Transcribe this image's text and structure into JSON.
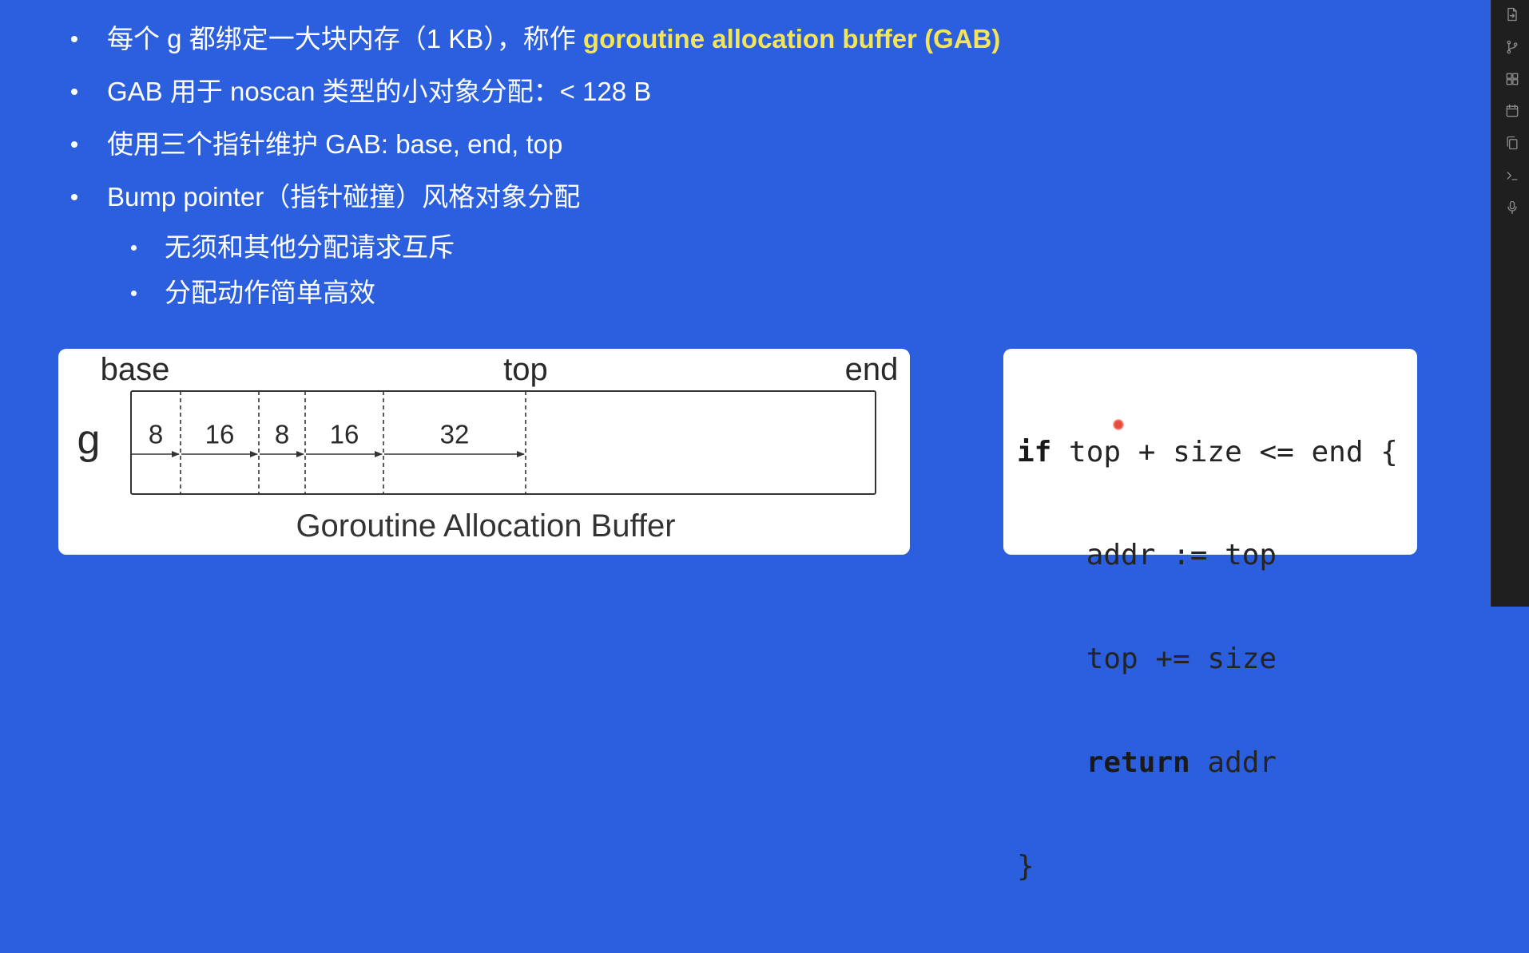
{
  "slide": {
    "bullets": [
      {
        "text": "每个 g 都绑定一大块内存（1 KB），称作 ",
        "highlight": "goroutine allocation buffer (GAB)"
      },
      {
        "text": "GAB 用于 noscan 类型的小对象分配：< 128 B"
      },
      {
        "text": "使用三个指针维护 GAB: base, end, top"
      },
      {
        "text": "Bump pointer（指针碰撞）风格对象分配"
      }
    ],
    "sub_bullets": [
      {
        "text": "无须和其他分配请求互斥"
      },
      {
        "text": "分配动作简单高效"
      }
    ]
  },
  "diagram": {
    "pointer_labels": {
      "base": "base",
      "top": "top",
      "end": "end"
    },
    "goroutine_label": "g",
    "segments": [
      8,
      16,
      8,
      16,
      32
    ],
    "caption": "Goroutine Allocation Buffer"
  },
  "code": {
    "lines": [
      {
        "keyword": "if",
        "text": " top + size <= end {"
      },
      {
        "text": "addr := top"
      },
      {
        "text": "top += size"
      },
      {
        "keyword": "return",
        "text": " addr"
      },
      {
        "text": "}"
      }
    ]
  },
  "sidebar": {
    "icons": [
      "file-export-icon",
      "source-control-icon",
      "apps-grid-icon",
      "calendar-icon",
      "copy-icon",
      "terminal-icon",
      "microphone-icon"
    ]
  },
  "colors": {
    "background": "#2b5fdd",
    "highlight": "#f3e55a",
    "sidebar": "#1f1f1f",
    "laser": "#e84a3c"
  }
}
